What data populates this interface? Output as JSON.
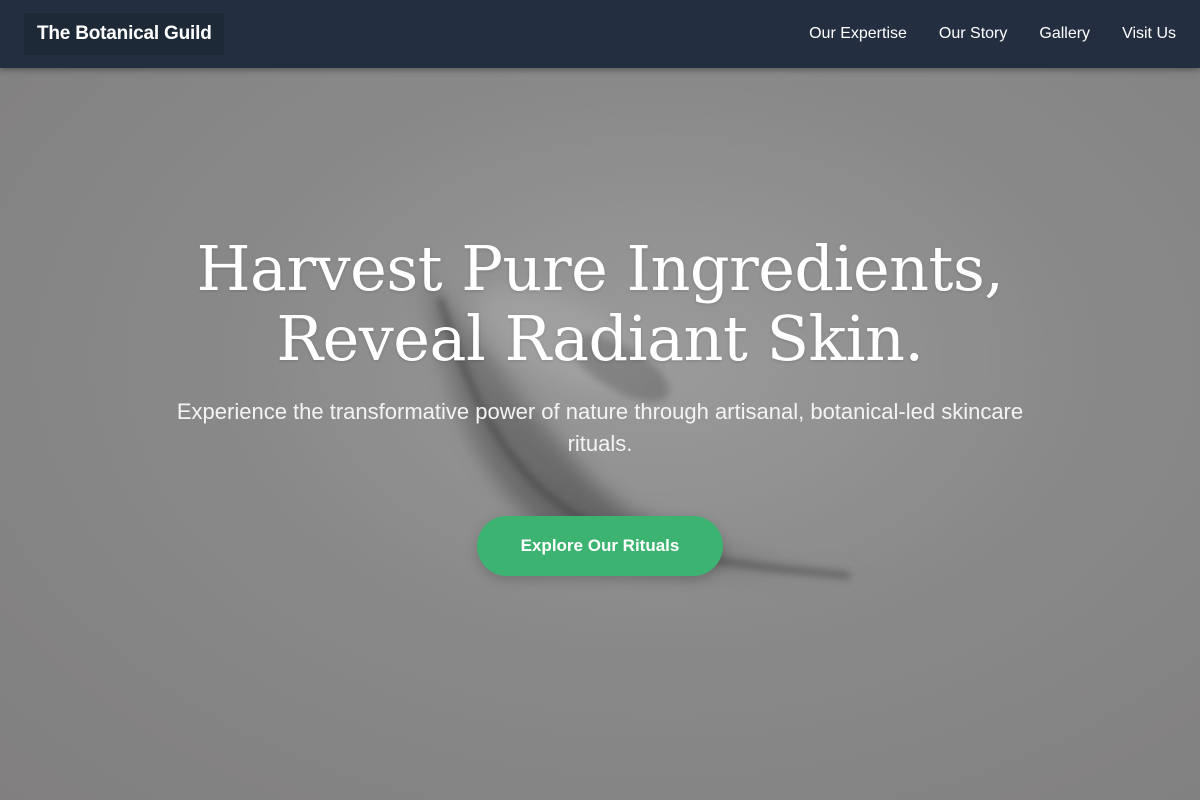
{
  "header": {
    "logo": "The Botanical Guild",
    "nav": [
      {
        "label": "Our Expertise"
      },
      {
        "label": "Our Story"
      },
      {
        "label": "Gallery"
      },
      {
        "label": "Visit Us"
      }
    ]
  },
  "hero": {
    "title_line1": "Harvest Pure Ingredients,",
    "title_line2": "Reveal Radiant Skin.",
    "subtitle": "Experience the transformative power of nature through artisanal, botanical-led skincare rituals.",
    "cta_label": "Explore Our Rituals"
  },
  "colors": {
    "header_bg": "#232f40",
    "accent": "#3cb371"
  }
}
